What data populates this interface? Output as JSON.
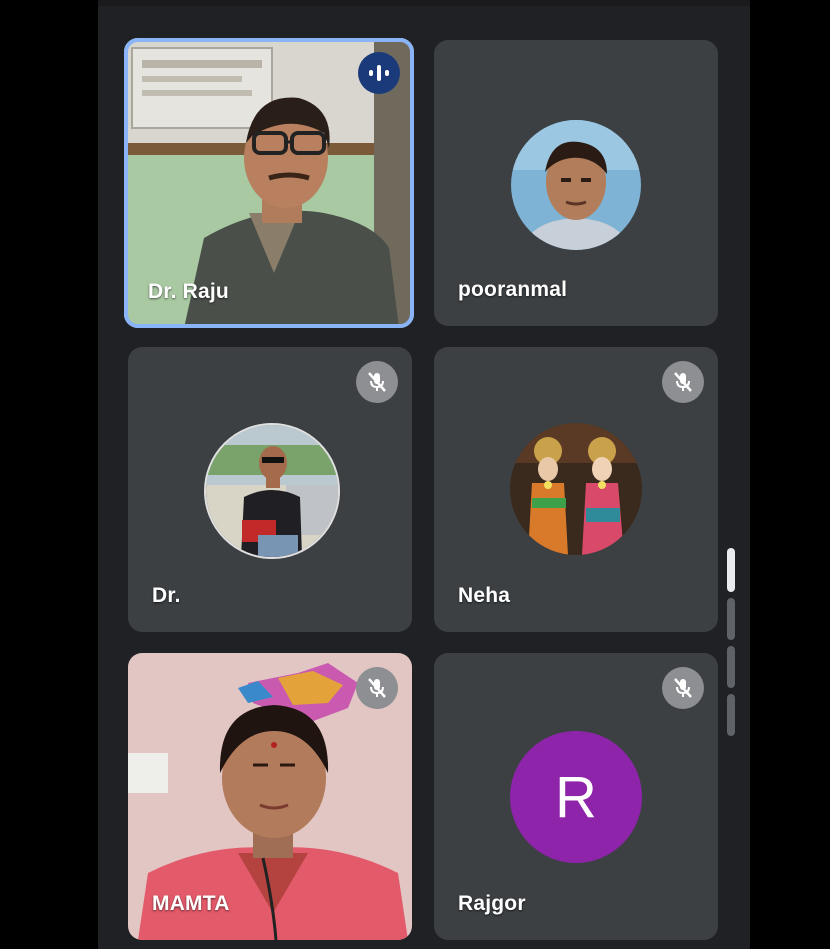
{
  "colors": {
    "background": "#202124",
    "tile": "#3c4043",
    "active_border": "#8ab4f8",
    "muted_badge": "#8d8f92",
    "speaking_badge": "#1a3a7a",
    "avatar_letter_bg": "#8e24aa"
  },
  "participants": [
    {
      "name": "Dr. Raju",
      "state": "speaking",
      "view": "video",
      "icon": "speaking-indicator-icon"
    },
    {
      "name": "pooranmal",
      "state": "unmuted",
      "view": "avatar-photo"
    },
    {
      "name": "Dr.",
      "state": "muted",
      "view": "avatar-photo",
      "icon": "mic-off-icon"
    },
    {
      "name": "Neha",
      "state": "muted",
      "view": "avatar-photo",
      "icon": "mic-off-icon"
    },
    {
      "name": "MAMTA",
      "state": "muted",
      "view": "video",
      "icon": "mic-off-icon"
    },
    {
      "name": "Rajgor",
      "state": "muted",
      "view": "avatar-letter",
      "avatar_letter": "R",
      "icon": "mic-off-icon"
    }
  ]
}
